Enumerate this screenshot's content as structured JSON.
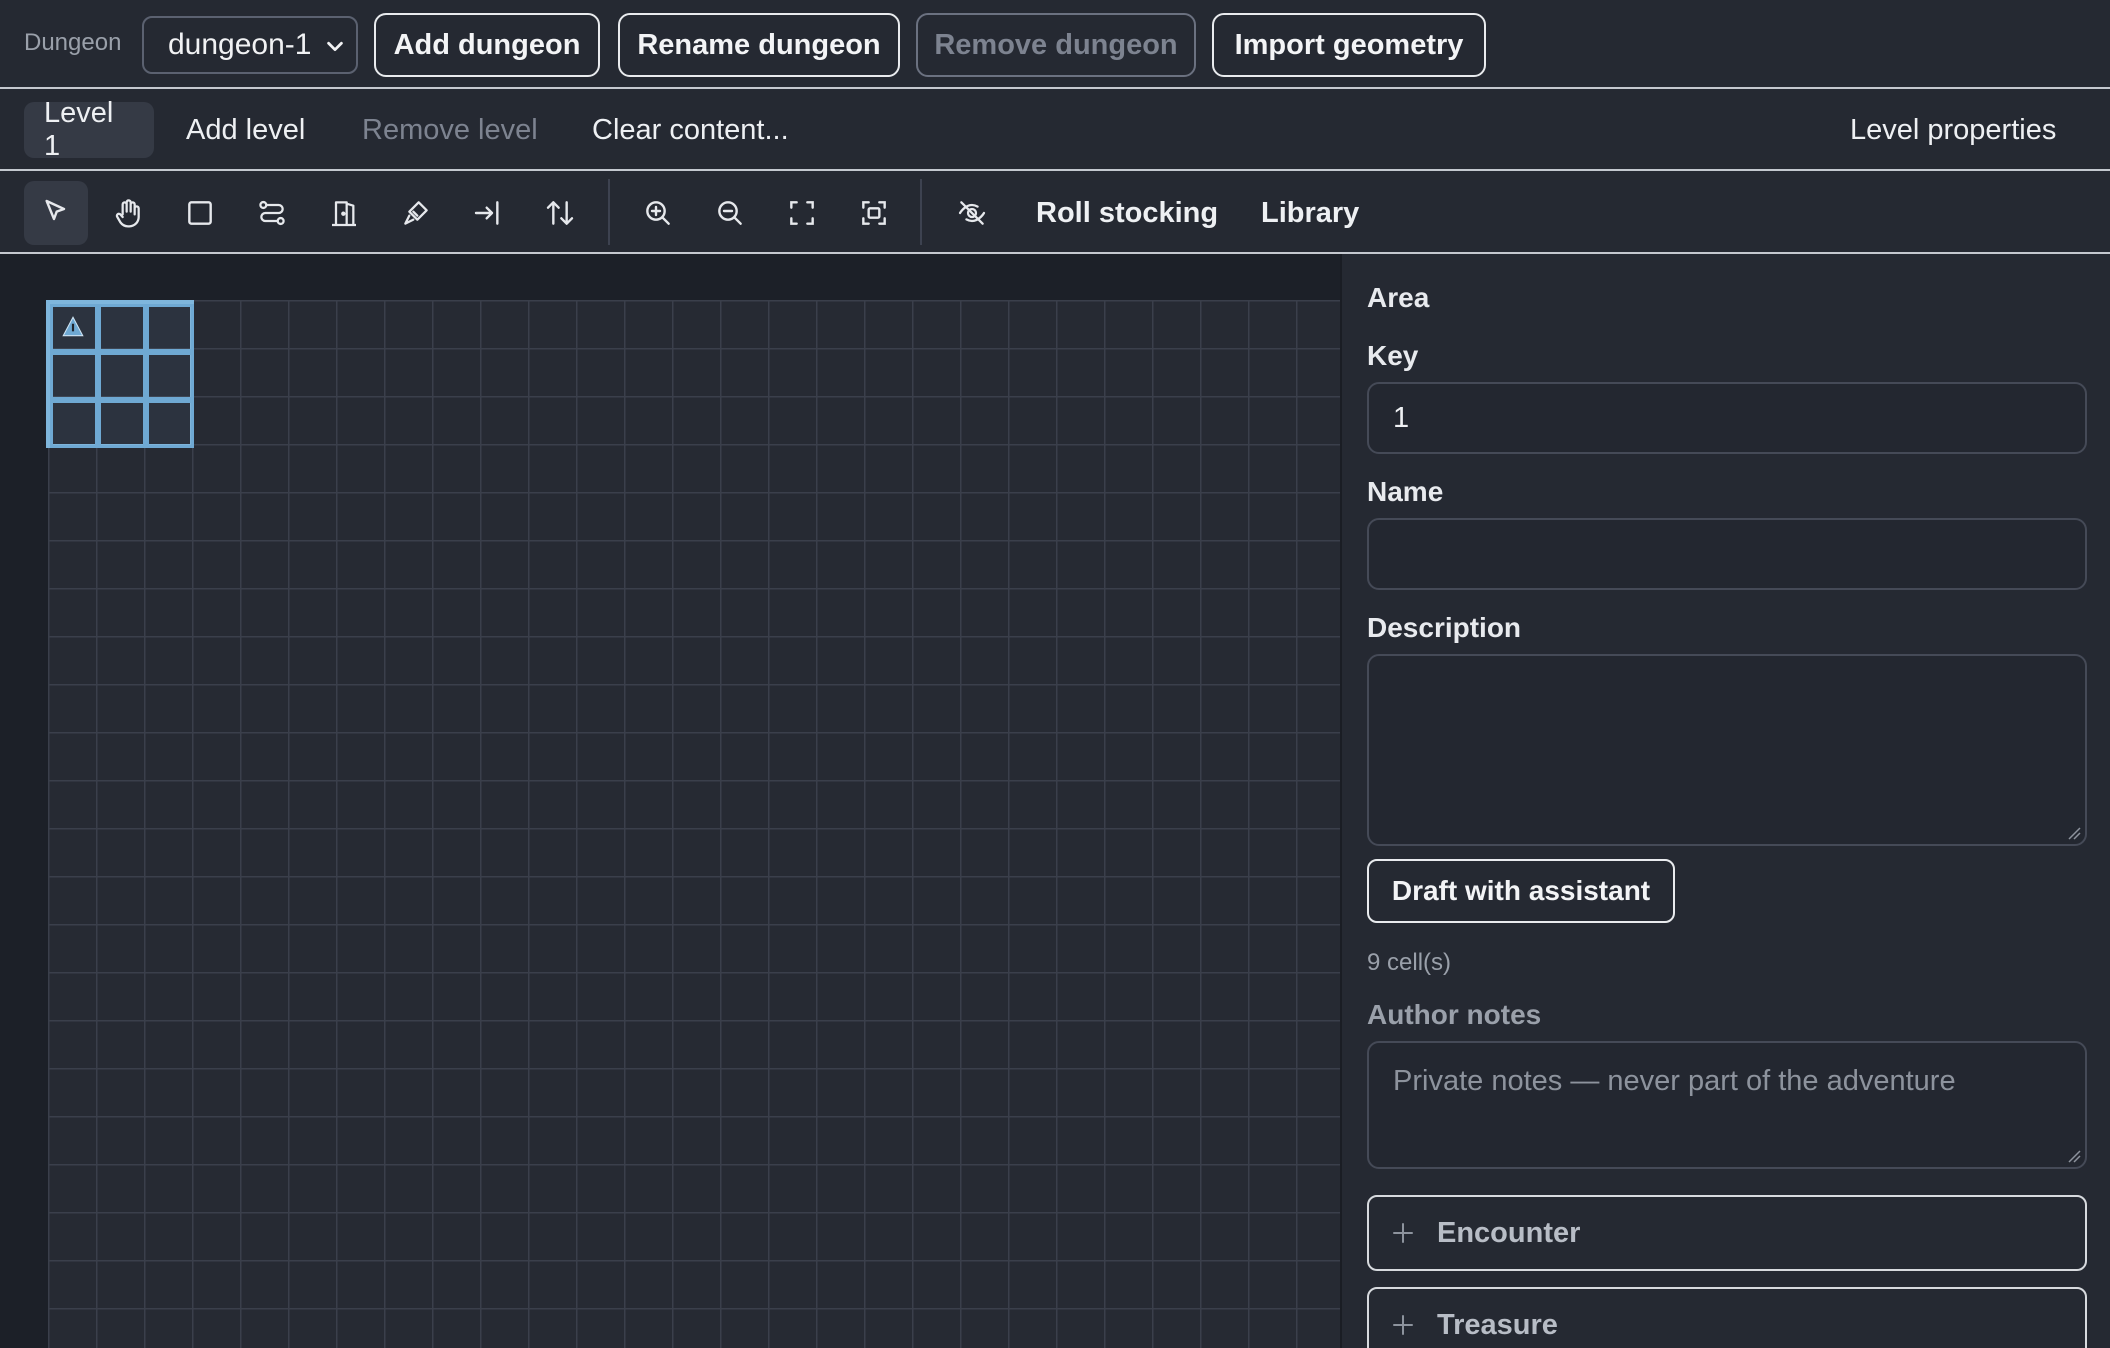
{
  "dungeon_bar": {
    "label": "Dungeon",
    "selected_dungeon": "dungeon-1",
    "add_label": "Add dungeon",
    "rename_label": "Rename dungeon",
    "remove_label": "Remove dungeon",
    "import_label": "Import geometry"
  },
  "level_bar": {
    "tabs": [
      {
        "label": "Level 1",
        "active": true
      },
      {
        "label": "Add level"
      },
      {
        "label": "Remove level",
        "disabled": true
      },
      {
        "label": "Clear content..."
      }
    ],
    "properties_label": "Level properties"
  },
  "toolbar": {
    "tools": [
      "select-icon",
      "pan-icon",
      "rectangle-icon",
      "path-icon",
      "door-icon",
      "paint-icon",
      "entrance-icon",
      "stairs-icon"
    ],
    "view_tools": [
      "zoom-in-icon",
      "zoom-out-icon",
      "fit-icon",
      "fit-selection-icon",
      "hide-icon"
    ],
    "roll_label": "Roll stocking",
    "library_label": "Library"
  },
  "map": {
    "selected_area_cells": 9,
    "grid_color": "#3a3f4b",
    "selection_color": "#7fb6dc"
  },
  "panel": {
    "section_title": "Area",
    "key_label": "Key",
    "key_value": "1",
    "name_label": "Name",
    "name_value": "",
    "description_label": "Description",
    "description_value": "",
    "draft_label": "Draft with assistant",
    "cell_count": "9 cell(s)",
    "notes_label": "Author notes",
    "notes_placeholder": "Private notes — never part of the adventure",
    "encounter_label": "Encounter",
    "treasure_label": "Treasure"
  }
}
